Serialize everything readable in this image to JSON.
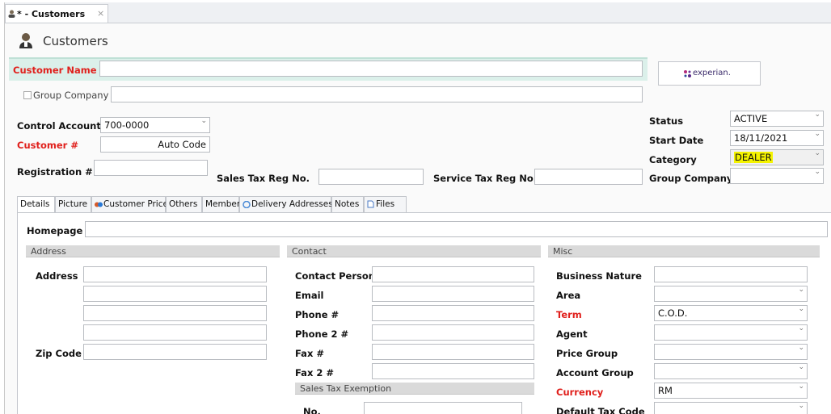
{
  "doc_tab": {
    "label": "* - Customers",
    "close": "×"
  },
  "page": {
    "title": "Customers"
  },
  "header": {
    "customer_name_label": "Customer Name",
    "customer_name_value": "",
    "group_company_label": "Group Company",
    "experian_label": "experian.",
    "control_account_label": "Control Account",
    "control_account_value": "700-0000",
    "customer_no_label": "Customer #",
    "customer_no_value": "Auto Code",
    "registration_label": "Registration #",
    "sales_tax_label": "Sales Tax Reg No.",
    "service_tax_label": "Service Tax Reg No.",
    "status_label": "Status",
    "status_value": "ACTIVE",
    "start_date_label": "Start Date",
    "start_date_value": "18/11/2021",
    "category_label": "Category",
    "category_value": "DEALER",
    "group_company2_label": "Group Company",
    "group_company2_value": ""
  },
  "tabs": [
    "Details",
    "Picture",
    "Customer Price",
    "Others",
    "Member",
    "Delivery Addresses",
    "Notes",
    "Files"
  ],
  "details": {
    "homepage_label": "Homepage",
    "address": {
      "header": "Address",
      "address_label": "Address",
      "zip_label": "Zip Code"
    },
    "contact": {
      "header": "Contact",
      "contact_person": "Contact Person",
      "email": "Email",
      "phone": "Phone #",
      "phone2": "Phone 2 #",
      "fax": "Fax #",
      "fax2": "Fax 2 #",
      "sales_tax_exemption": "Sales Tax Exemption",
      "no": "No."
    },
    "misc": {
      "header": "Misc",
      "business_nature": "Business Nature",
      "area": "Area",
      "term": "Term",
      "term_value": "C.O.D.",
      "agent": "Agent",
      "price_group": "Price Group",
      "account_group": "Account Group",
      "currency": "Currency",
      "currency_value": "RM",
      "default_tax_code": "Default Tax Code"
    }
  },
  "colors": {
    "required_label": "#e0201c",
    "highlight": "#f4f300",
    "name_bar": "#dbf0ea"
  }
}
